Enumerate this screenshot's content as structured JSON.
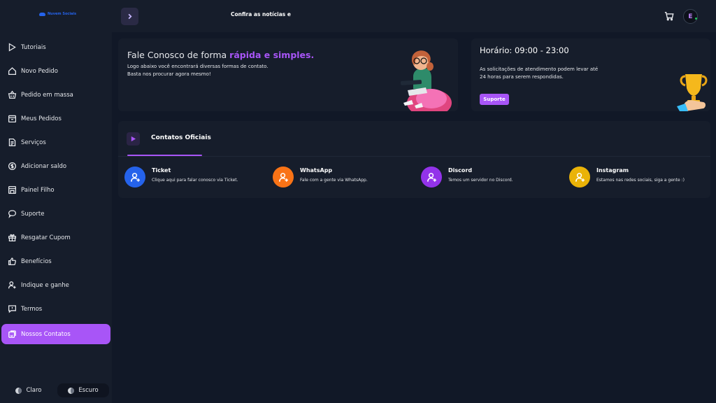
{
  "brand": {
    "name": "Nuvem Sociais",
    "color": "#2563eb"
  },
  "accent": "#a855f7",
  "sidebar": {
    "items": [
      {
        "label": "Tutoriais",
        "icon": "play-icon"
      },
      {
        "label": "Novo Pedido",
        "icon": "home-icon"
      },
      {
        "label": "Pedido em massa",
        "icon": "basket-icon"
      },
      {
        "label": "Meus Pedidos",
        "icon": "orders-icon"
      },
      {
        "label": "Serviços",
        "icon": "document-icon"
      },
      {
        "label": "Adicionar saldo",
        "icon": "coin-icon"
      },
      {
        "label": "Painel Filho",
        "icon": "panel-icon"
      },
      {
        "label": "Suporte",
        "icon": "chat-icon"
      },
      {
        "label": "Resgatar Cupom",
        "icon": "gift-icon"
      },
      {
        "label": "Benefícios",
        "icon": "thumbs-up-icon"
      },
      {
        "label": "Indique e ganhe",
        "icon": "user-plus-icon"
      },
      {
        "label": "Termos",
        "icon": "terms-icon"
      },
      {
        "label": "Nossos Contatos",
        "icon": "contacts-icon",
        "active": true
      }
    ],
    "theme": {
      "light_label": "Claro",
      "dark_label": "Escuro",
      "selected": "Escuro"
    }
  },
  "topbar": {
    "marquee": "Confira as notícias e atu",
    "cart_icon": "cart-icon",
    "avatar_initial": "E"
  },
  "contact_card": {
    "title_prefix": "Fale Conosco de forma ",
    "title_highlight": "rápida e simples.",
    "line1": "Logo abaixo você encontrará diversas formas de contato.",
    "line2": "Basta nos procurar agora mesmo!"
  },
  "hours_card": {
    "title": "Horário: 09:00 - 23:00",
    "line1": "As solicitações de atendimento podem levar até",
    "line2": "24 horas para serem respondidas.",
    "button": "Suporte"
  },
  "official": {
    "tab_title": "Contatos Oficiais",
    "contacts": [
      {
        "name": "Ticket",
        "desc": "Clique aqui para falar conosco via Ticket.",
        "color": "#2563eb"
      },
      {
        "name": "WhatsApp",
        "desc": "Fale com a gente via WhatsApp.",
        "color": "#f97316"
      },
      {
        "name": "Discord",
        "desc": "Temos um servidor no Discord.",
        "color": "#9333ea"
      },
      {
        "name": "Instagram",
        "desc": "Estamos nas redes sociais, siga a gente :)",
        "color": "#eab308"
      }
    ]
  }
}
